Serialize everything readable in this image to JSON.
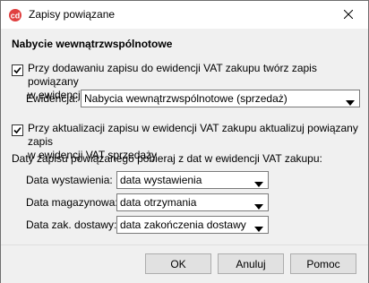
{
  "window": {
    "title": "Zapisy powiązane",
    "accent_color": "#e04040"
  },
  "section": {
    "title": "Nabycie wewnątrzwspólnotowe"
  },
  "option_create": {
    "checked": true,
    "line1": "Przy dodawaniu zapisu do ewidencji VAT zakupu twórz zapis powiązany",
    "line2": "w ewidencji VAT sprzedaży"
  },
  "ewidencja": {
    "label": "Ewidencja:",
    "value": "Nabycia wewnątrzwspólnotowe (sprzedaż)"
  },
  "option_update": {
    "checked": true,
    "line1": "Przy aktualizacji zapisu w ewidencji VAT zakupu aktualizuj powiązany zapis",
    "line2": "w ewidencji VAT sprzedaży"
  },
  "dates": {
    "heading": "Daty zapisu powiązanego pobieraj z dat w ewidencji VAT zakupu:",
    "rows": [
      {
        "label": "Data wystawienia:",
        "value": "data wystawienia"
      },
      {
        "label": "Data magazynowa:",
        "value": "data otrzymania"
      },
      {
        "label": "Data zak. dostawy:",
        "value": "data zakończenia dostawy"
      }
    ]
  },
  "buttons": {
    "ok": "OK",
    "cancel": "Anuluj",
    "help": "Pomoc"
  },
  "icons": {
    "app": "app-logo-icon",
    "close": "close-icon",
    "checkbox": "checkmark-icon",
    "dropdown": "chevron-down-icon"
  }
}
